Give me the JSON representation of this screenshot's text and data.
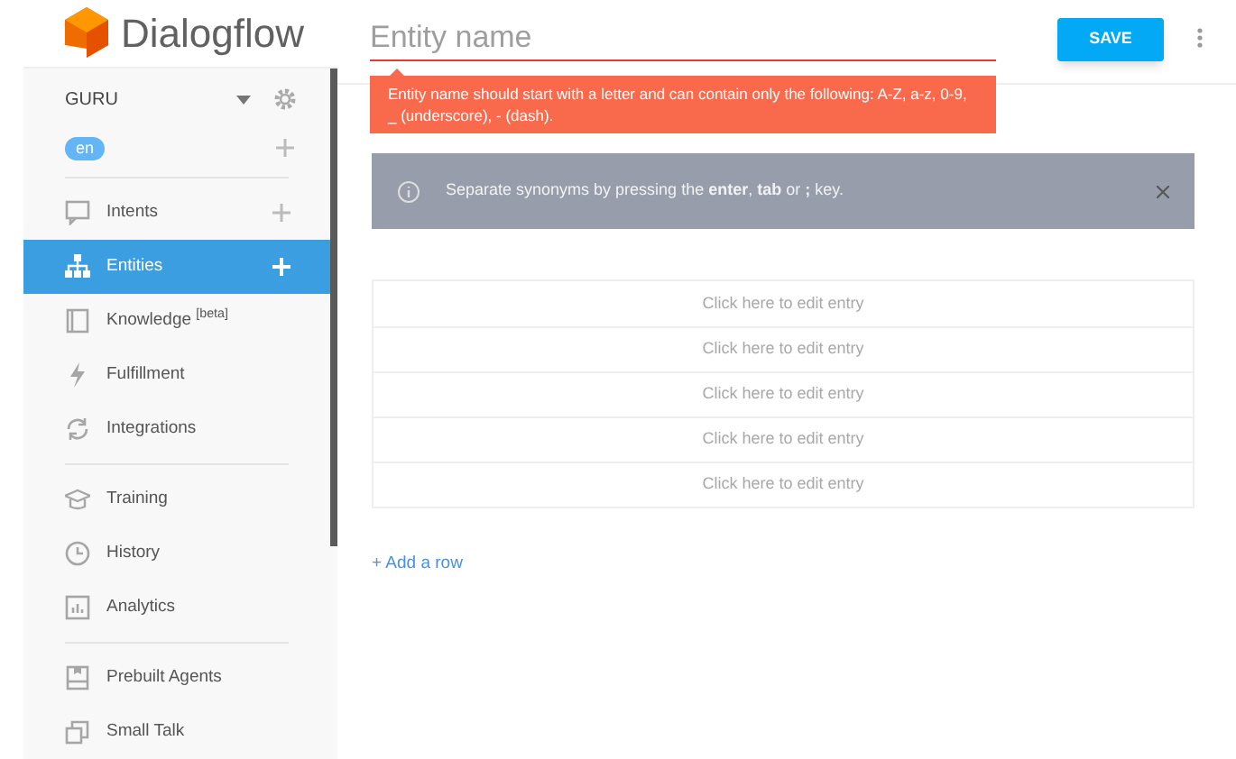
{
  "brand": {
    "name": "Dialogflow"
  },
  "agent": {
    "name": "GURU",
    "language": "en"
  },
  "nav_groups": [
    [
      {
        "label": "Intents",
        "selected": false,
        "addable": true
      },
      {
        "label": "Entities",
        "selected": true,
        "addable": true
      },
      {
        "label": "Knowledge $^{[beta]}$",
        "selected": false,
        "addable": false
      },
      {
        "label": "Fulfillment",
        "selected": false,
        "addable": false
      },
      {
        "label": "Integrations",
        "selected": false,
        "addable": false
      }
    ],
    [
      {
        "label": "Training",
        "selected": false,
        "addable": false
      },
      {
        "label": "History",
        "selected": false,
        "addable": false
      },
      {
        "label": "Analytics",
        "selected": false,
        "addable": false
      }
    ],
    [
      {
        "label": "Prebuilt Agents",
        "selected": false,
        "addable": false
      },
      {
        "label": "Small Talk",
        "selected": false,
        "addable": false
      }
    ]
  ],
  "entity_name": {
    "placeholder": "Entity name",
    "error": "Entity name should start with a letter and can contain only the following: A-Z, a-z, 0-9, _ (underscore), - (dash)."
  },
  "save_button": "SAVE",
  "info_banner": "Separate synonyms by pressing the **enter**, **tab** or **;** key.",
  "entries": [
    "Click here to edit entry",
    "Click here to edit entry",
    "Click here to edit entry",
    "Click here to edit entry",
    "Click here to edit entry"
  ],
  "add_row": "+ Add a row"
}
